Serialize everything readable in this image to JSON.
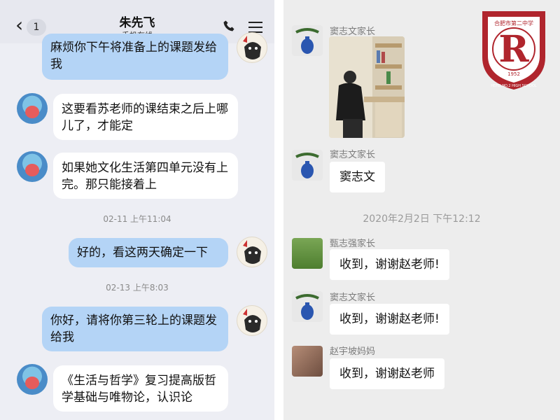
{
  "left_chat": {
    "back_badge": "1",
    "title": "朱先飞",
    "subtitle": "手机在线",
    "messages": [
      {
        "text": "麻烦你下午将准备上的课题发给我"
      },
      {
        "text": "这要看苏老师的课结束之后上哪儿了，才能定"
      },
      {
        "text": "如果她文化生活第四单元没有上完。那只能接着上"
      },
      {
        "text": "好的，看这两天确定一下"
      },
      {
        "text": "你好，请将你第三轮上的课题发给我"
      },
      {
        "text": "《生活与哲学》复习提高版哲学基础与唯物论，认识论"
      }
    ],
    "timestamps": [
      "02-11 上午11:04",
      "02-13 上午8:03"
    ]
  },
  "right_chat": {
    "logo": {
      "top_text": "合肥市第二中学",
      "ring_text": "HEFEI NO.2 HIGH SCHOOL",
      "year": "1952"
    },
    "messages": [
      {
        "sender": "窦志文家长",
        "text": ""
      },
      {
        "sender": "窦志文家长",
        "text": "窦志文"
      },
      {
        "sender": "甄志强家长",
        "text": "收到，谢谢赵老师!"
      },
      {
        "sender": "窦志文家长",
        "text": "收到，谢谢赵老师!"
      },
      {
        "sender": "赵宇坡妈妈",
        "text": "收到，谢谢赵老师"
      }
    ],
    "timestamp": "2020年2月2日 下午12:12"
  },
  "colors": {
    "outgoing_bubble": "#b4d4f6",
    "left_bg": "#edeef4",
    "right_bg": "#ededed",
    "logo_red": "#b0252d"
  }
}
